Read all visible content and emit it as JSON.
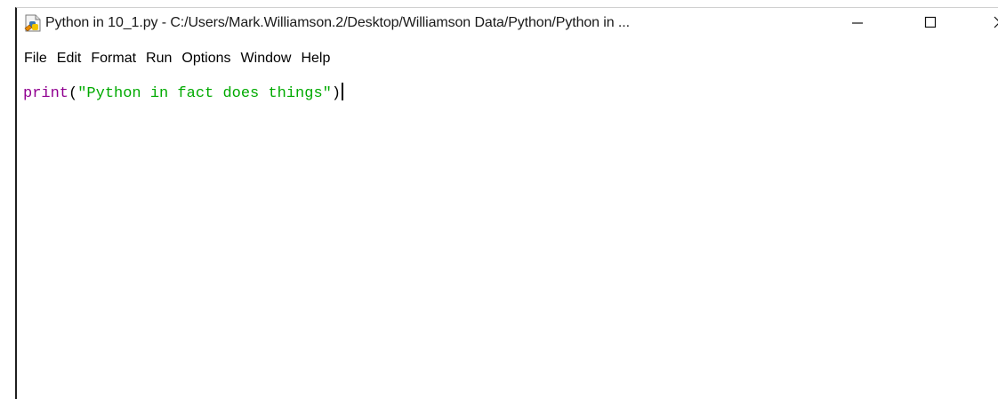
{
  "window": {
    "title": "Python in 10_1.py - C:/Users/Mark.Williamson.2/Desktop/Williamson Data/Python/Python in ...",
    "icon": "idle-file-icon",
    "controls": {
      "minimize_icon": "minimize-icon",
      "maximize_icon": "maximize-icon",
      "close_icon": "close-icon"
    }
  },
  "menubar": {
    "items": [
      "File",
      "Edit",
      "Format",
      "Run",
      "Options",
      "Window",
      "Help"
    ]
  },
  "editor": {
    "tokens": {
      "builtin": "print",
      "open_paren": "(",
      "string": "\"Python in fact does things\"",
      "close_paren": ")"
    },
    "colors": {
      "builtin": "#900090",
      "string": "#00aa00",
      "punct": "#000000"
    }
  }
}
